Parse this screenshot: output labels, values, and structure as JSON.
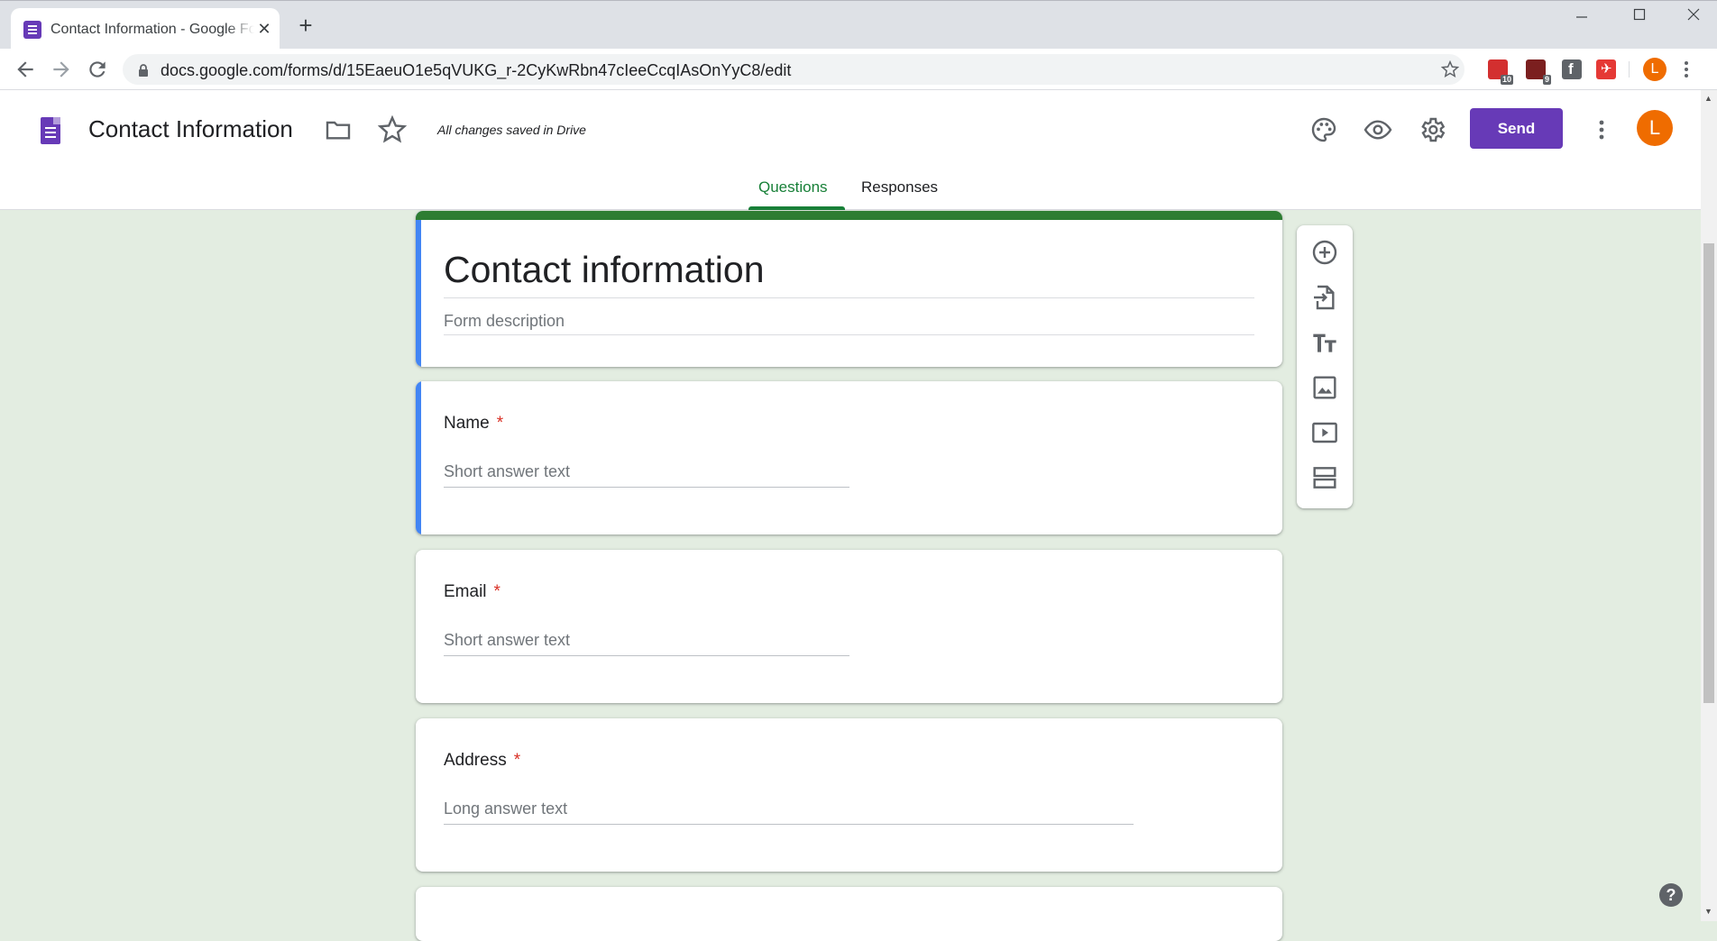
{
  "browser": {
    "tab_title": "Contact Information - Google Forms",
    "new_tab": "+",
    "url": "docs.google.com/forms/d/15EaeuO1e5qVUKG_r-2CyKwRbn47cIeeCcqIAsOnYyC8/edit",
    "profile_initial": "L",
    "extensions": [
      {
        "name": "adblock-icon",
        "badge": "10",
        "color": "#d32f2f"
      },
      {
        "name": "ublock-icon",
        "badge": "9",
        "color": "#7b1f1f"
      },
      {
        "name": "facebook-icon",
        "badge": "",
        "color": "#5f6368"
      },
      {
        "name": "pin-extension-icon",
        "badge": "",
        "color": "#e53935"
      }
    ]
  },
  "header": {
    "doc_title": "Contact Information",
    "saved_status": "All changes saved in Drive",
    "send_label": "Send",
    "avatar_initial": "L",
    "tabs": {
      "questions": "Questions",
      "responses": "Responses"
    }
  },
  "form": {
    "title": "Contact information",
    "description_placeholder": "Form description",
    "questions": [
      {
        "title": "Name",
        "required": "*",
        "answer_placeholder": "Short answer text"
      },
      {
        "title": "Email",
        "required": "*",
        "answer_placeholder": "Short answer text"
      },
      {
        "title": "Address",
        "required": "*",
        "answer_placeholder": "Long answer text"
      }
    ]
  },
  "side_toolbar": [
    "add-question-icon",
    "import-questions-icon",
    "add-title-icon",
    "add-image-icon",
    "add-video-icon",
    "add-section-icon"
  ],
  "help_label": "?",
  "colors": {
    "accent": "#673ab7",
    "tab_active": "#188038",
    "background": "#e3ede1",
    "title_bar": "#2e7d32",
    "focus": "#4285f4"
  }
}
